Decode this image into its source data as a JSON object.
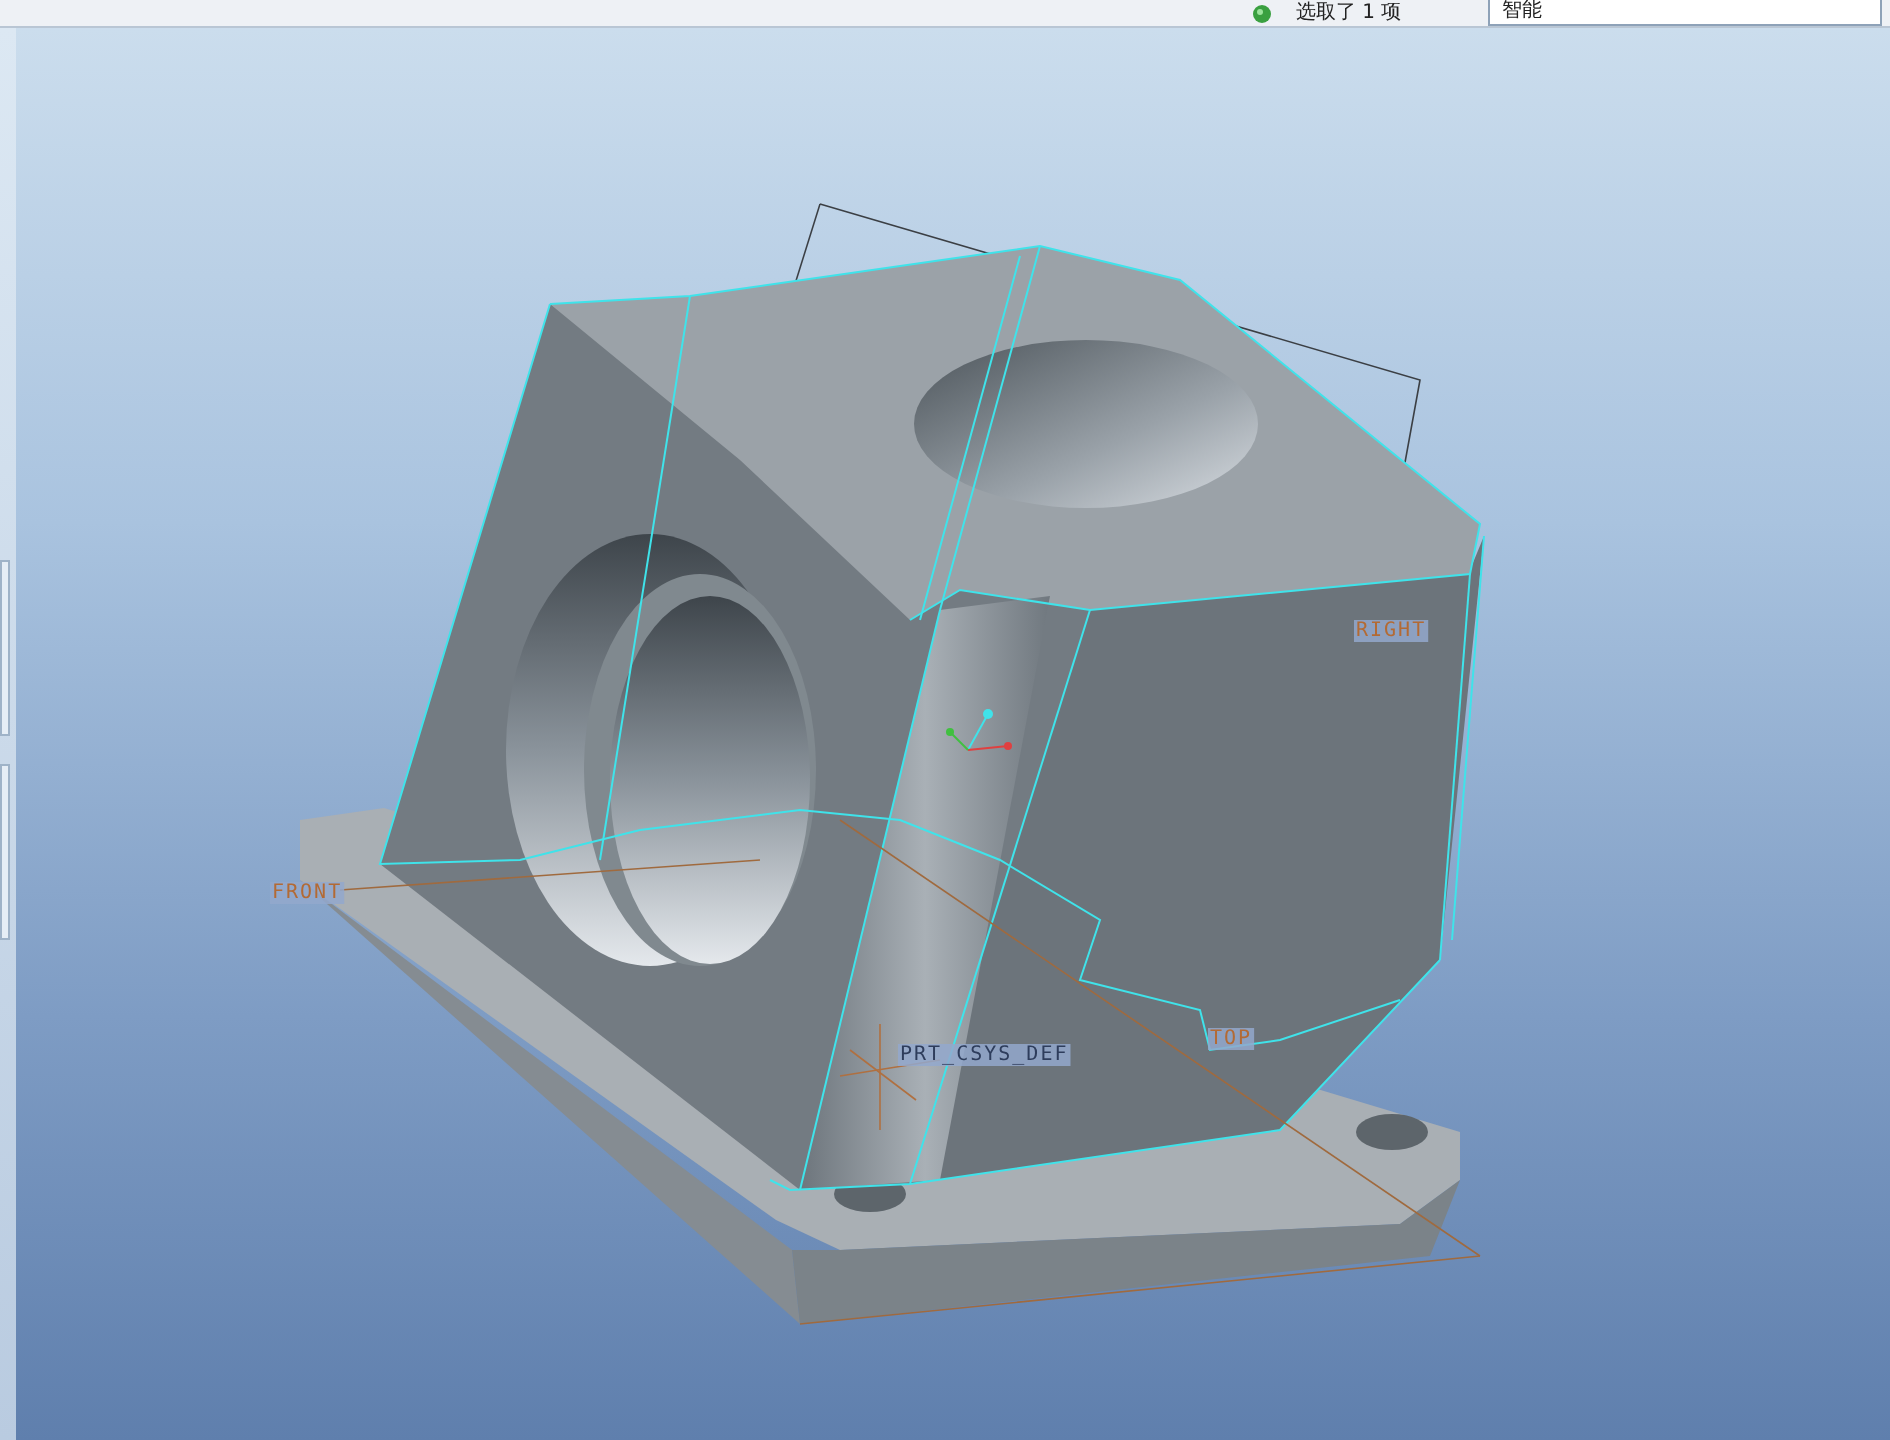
{
  "status_bar": {
    "selection_text": "选取了 1 项",
    "filter": {
      "value": "智能"
    }
  },
  "viewport": {
    "datum_labels": [
      {
        "kind": "plane",
        "text": "FRONT"
      },
      {
        "kind": "plane",
        "text": "RIGHT"
      },
      {
        "kind": "plane",
        "text": "TOP"
      },
      {
        "kind": "csys",
        "text": "PRT_CSYS_DEF"
      }
    ]
  }
}
